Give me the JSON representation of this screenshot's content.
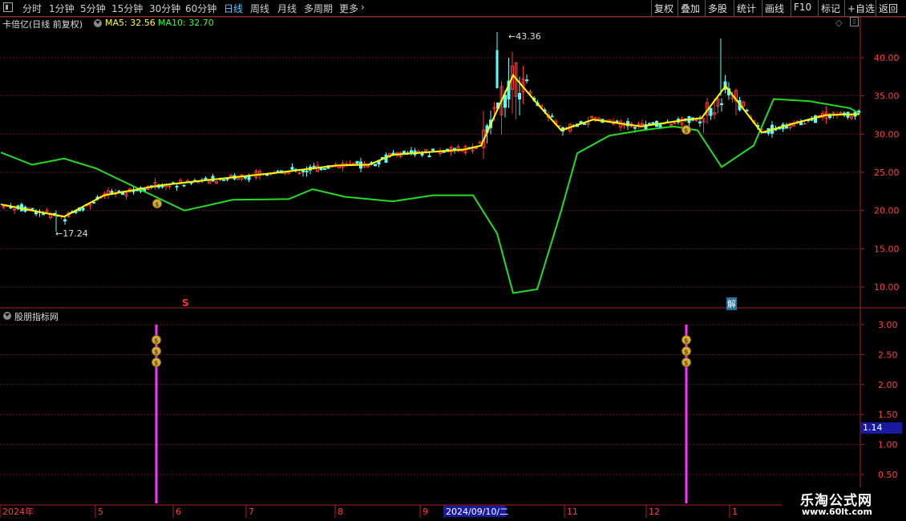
{
  "toolbar": {
    "periods": [
      "分时",
      "1分钟",
      "5分钟",
      "15分钟",
      "30分钟",
      "60分钟",
      "日线",
      "周线",
      "月线",
      "多周期",
      "更多"
    ],
    "active_period": "日线",
    "right_buttons": [
      "复权",
      "叠加",
      "多股",
      "统计",
      "画线",
      "F10",
      "标记",
      "+自选",
      "返回"
    ]
  },
  "main_pane": {
    "stock_title": "卡倍亿(日线 前复权)",
    "ma5_label": "MA5: 32.56",
    "ma10_label": "MA10: 32.70",
    "high_marker": "43.36",
    "low_marker": "17.24",
    "s_marker": "S",
    "jie_marker": "解"
  },
  "sub_pane": {
    "title": "股朋指标网",
    "current_value": "1.14"
  },
  "watermark": {
    "title": "乐淘公式网",
    "url": "www.60lt.com"
  },
  "colors": {
    "up": "#ff3232",
    "down": "#54ffff",
    "ma5": "#ffff00",
    "green_line": "#22dd22",
    "signal": "#ff33ff",
    "grid": "#661515",
    "axis": "#aa2020"
  },
  "chart_data": [
    {
      "type": "candlestick",
      "ylim": [
        8.0,
        45.0
      ],
      "y_ticks": [
        "10.00",
        "15.00",
        "20.00",
        "25.00",
        "30.00",
        "35.00",
        "40.00"
      ],
      "x_tick_labels": [
        "2024年",
        "5",
        "6",
        "7",
        "8",
        "9",
        "2024/09/10/二",
        "11",
        "12",
        "1"
      ],
      "annotations": {
        "high": 43.36,
        "low": 17.24
      },
      "series": [
        {
          "name": "MA5",
          "description": "yellow moving average, approximate values at selected points",
          "values": [
            [
              1,
              20.8
            ],
            [
              60,
              19.6
            ],
            [
              80,
              19.2
            ],
            [
              130,
              22.0
            ],
            [
              200,
              23.3
            ],
            [
              260,
              24.0
            ],
            [
              350,
              25.0
            ],
            [
              420,
              25.9
            ],
            [
              460,
              26.0
            ],
            [
              490,
              27.3
            ],
            [
              580,
              28.0
            ],
            [
              600,
              28.5
            ],
            [
              640,
              37.7
            ],
            [
              670,
              34.0
            ],
            [
              700,
              30.5
            ],
            [
              740,
              31.9
            ],
            [
              800,
              31.0
            ],
            [
              850,
              31.8
            ],
            [
              875,
              32.1
            ],
            [
              905,
              36.3
            ],
            [
              950,
              30.2
            ],
            [
              990,
              31.4
            ],
            [
              1030,
              32.5
            ],
            [
              1072,
              32.6
            ]
          ]
        },
        {
          "name": "",
          "description": "green line, approximate values at selected points",
          "values": [
            [
              1,
              27.6
            ],
            [
              40,
              26.0
            ],
            [
              80,
              26.8
            ],
            [
              120,
              25.5
            ],
            [
              170,
              23.0
            ],
            [
              230,
              20.0
            ],
            [
              290,
              21.4
            ],
            [
              360,
              21.5
            ],
            [
              390,
              22.8
            ],
            [
              430,
              21.8
            ],
            [
              490,
              21.2
            ],
            [
              540,
              22.0
            ],
            [
              590,
              22.0
            ],
            [
              620,
              17.0
            ],
            [
              640,
              9.2
            ],
            [
              670,
              9.7
            ],
            [
              700,
              20.0
            ],
            [
              720,
              27.5
            ],
            [
              760,
              29.8
            ],
            [
              800,
              30.5
            ],
            [
              840,
              31.0
            ],
            [
              870,
              30.5
            ],
            [
              900,
              25.7
            ],
            [
              940,
              28.5
            ],
            [
              965,
              34.6
            ],
            [
              1010,
              34.3
            ],
            [
              1060,
              33.4
            ],
            [
              1072,
              32.7
            ]
          ]
        }
      ]
    },
    {
      "type": "bar",
      "ylim": [
        0,
        3.2
      ],
      "y_ticks": [
        "0.50",
        "1.00",
        "1.50",
        "2.00",
        "2.50",
        "3.00"
      ],
      "signals": [
        {
          "x_label": "5-6",
          "value": 3.0
        },
        {
          "x_label": "12-1",
          "value": 3.0
        }
      ],
      "current_value": 1.14
    }
  ]
}
